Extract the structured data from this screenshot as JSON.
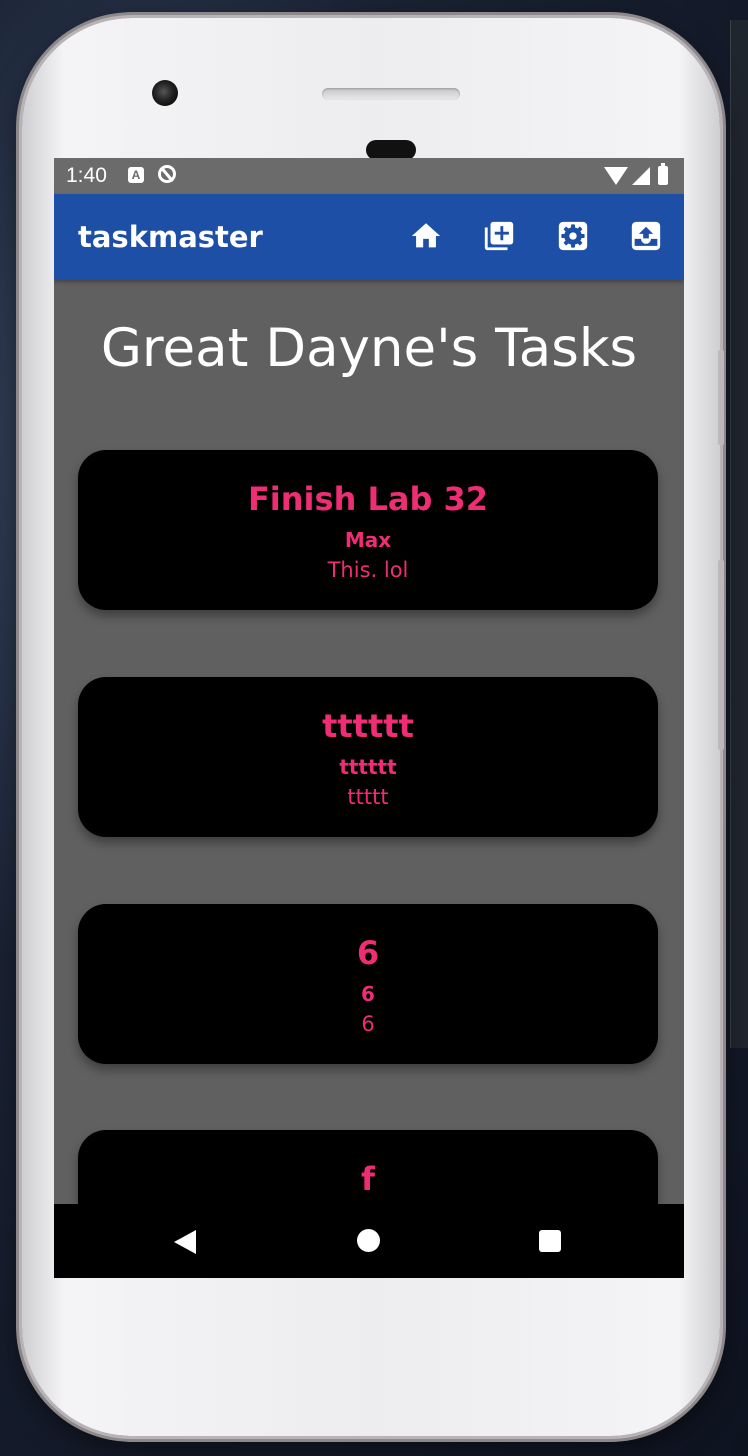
{
  "status_bar": {
    "time": "1:40",
    "notification_icons": [
      "a-icon",
      "sync-off-icon"
    ],
    "system_icons": [
      "wifi-icon",
      "signal-icon",
      "battery-icon"
    ]
  },
  "app_bar": {
    "title": "taskmaster",
    "actions": [
      "home-icon",
      "add-task-icon",
      "settings-icon",
      "archive-upload-icon"
    ],
    "color": "#1d4fa6"
  },
  "main": {
    "heading": "Great Dayne's Tasks",
    "tasks": [
      {
        "title": "Finish Lab 32",
        "assignee": "Max",
        "body": "This. lol"
      },
      {
        "title": "tttttt",
        "assignee": "tttttt",
        "body": "ttttt"
      },
      {
        "title": "6",
        "assignee": "6",
        "body": "6"
      },
      {
        "title": "f",
        "assignee": "",
        "body": ""
      }
    ],
    "accent_color": "#ee2d74"
  },
  "nav_bar": {
    "buttons": [
      "back-icon",
      "home-circle-icon",
      "recents-icon"
    ]
  }
}
